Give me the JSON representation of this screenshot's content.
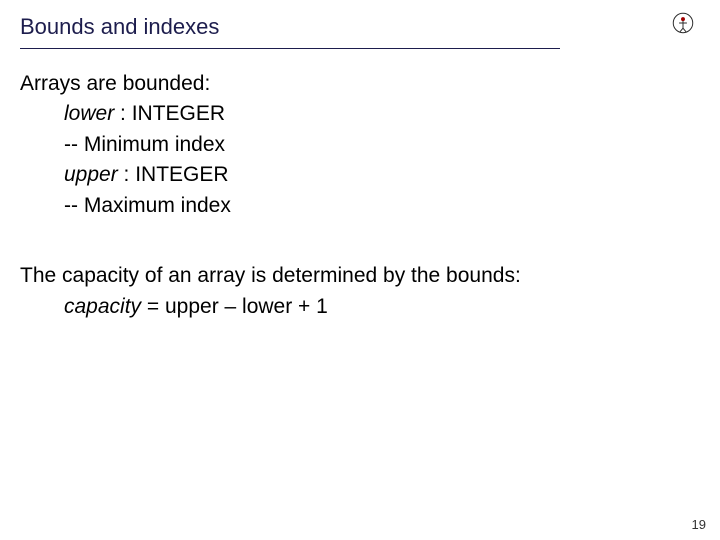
{
  "title": "Bounds and indexes",
  "intro": "Arrays are bounded:",
  "lower_decl_name": "lower",
  "lower_decl_type": " : INTEGER",
  "lower_comment": "-- Minimum index",
  "upper_decl_name": "upper",
  "upper_decl_type": " : INTEGER",
  "upper_comment": "-- Maximum index",
  "capacity_intro": "The capacity of an array is determined by the bounds:",
  "capacity_name": "capacity",
  "capacity_expr": " = upper – lower + 1",
  "page_number": "19"
}
